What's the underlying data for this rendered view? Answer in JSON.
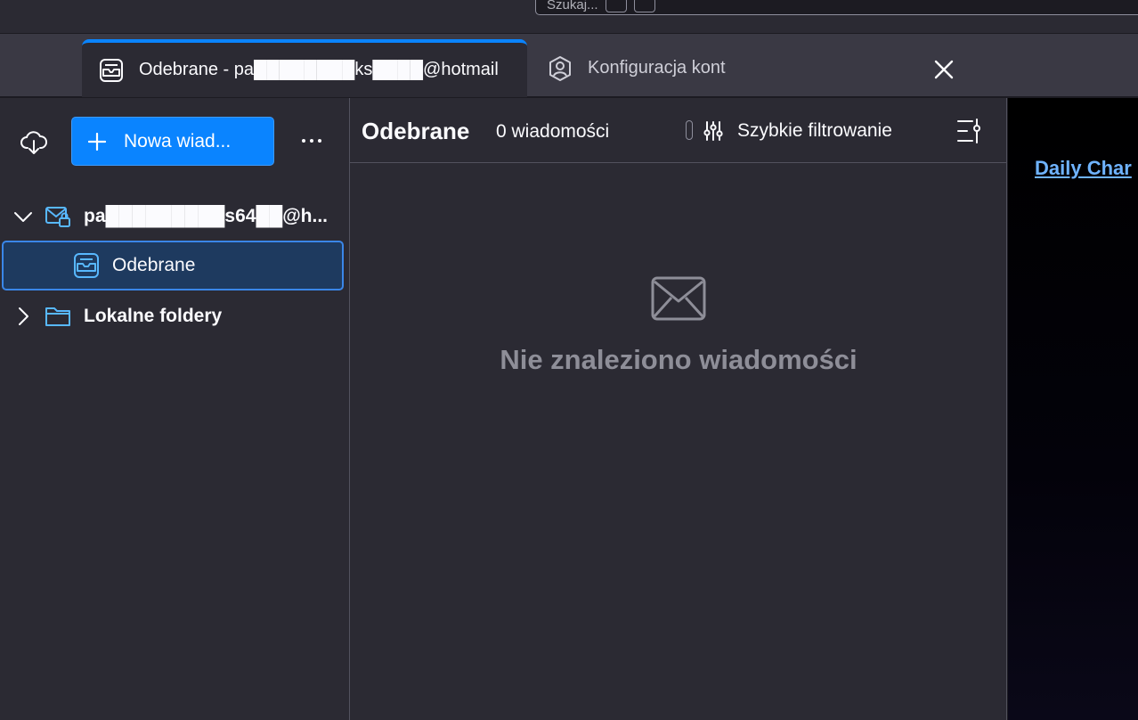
{
  "toolbar": {
    "search_placeholder": "Szukaj..."
  },
  "tabs": [
    {
      "label": "Odebrane - pa████████ks████@hotmail",
      "active": true,
      "icon": "inbox-icon"
    },
    {
      "label": "Konfiguracja kont",
      "active": false,
      "icon": "account-settings-icon"
    }
  ],
  "folder_pane": {
    "new_message_label": "Nowa wiad...",
    "account": {
      "label": "pa█████████s64██@h...",
      "icon": "mail-account-icon"
    },
    "inbox": {
      "label": "Odebrane",
      "icon": "inbox-icon"
    },
    "local_folders": {
      "label": "Lokalne foldery",
      "icon": "folder-icon"
    }
  },
  "message_list": {
    "title": "Odebrane",
    "count": "0 wiadomości",
    "quick_filter_label": "Szybkie filtrowanie",
    "empty_text": "Nie znaleziono wiadomości"
  },
  "preview": {
    "link_text": "Daily Char"
  },
  "colors": {
    "accent": "#0a84ff",
    "selection": "#1e3a5f",
    "background": "#2b2a33",
    "link": "#6fb3ff"
  }
}
